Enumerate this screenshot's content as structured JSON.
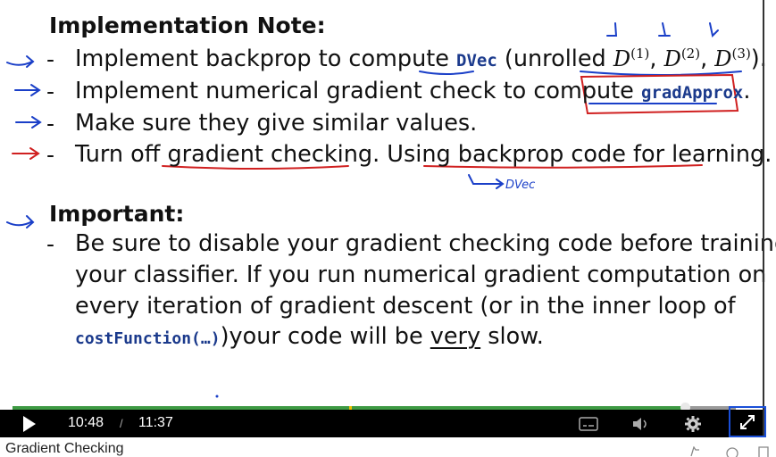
{
  "slide": {
    "heading": "Implementation Note:",
    "items": [
      {
        "pre": "Implement backprop to compute ",
        "code": "DVec",
        "post": " (unrolled "
      },
      {
        "pre": "Implement numerical gradient check to compute ",
        "code": "gradApprox",
        "post": "."
      },
      {
        "text": "Make sure they give similar values."
      },
      {
        "pre": "Turn off ",
        "u1": "gradient checking",
        "mid": ". Using ",
        "u2": "backprop code for learning",
        "post": "."
      }
    ],
    "math": {
      "d": "D",
      "s1": "(1)",
      "s2": "(2)",
      "s3": "(3)",
      "close": ")."
    },
    "handwritten_note": "DVec",
    "heading2": "Important:",
    "important": {
      "line1": "Be sure to disable your gradient checking code before training",
      "line2": "your classifier. If you run numerical gradient computation on",
      "line3": "every iteration of gradient descent (or in the inner loop of",
      "code": "costFunction(…)",
      "line4a": ")your code will be ",
      "very": "very",
      "line4b": " slow."
    },
    "dash": "-"
  },
  "player": {
    "current_time": "10:48",
    "separator": "/",
    "duration": "11:37",
    "progress_fraction": 0.93,
    "icons": [
      "play-icon",
      "subtitles-icon",
      "volume-icon",
      "settings-icon",
      "fullscreen-icon"
    ]
  },
  "below": {
    "video_title": "Gradient Checking"
  },
  "colors": {
    "accent": "#3e9a43",
    "ink_red": "#d02020",
    "ink_blue": "#1a3fc8",
    "code": "#1b3a8c"
  }
}
